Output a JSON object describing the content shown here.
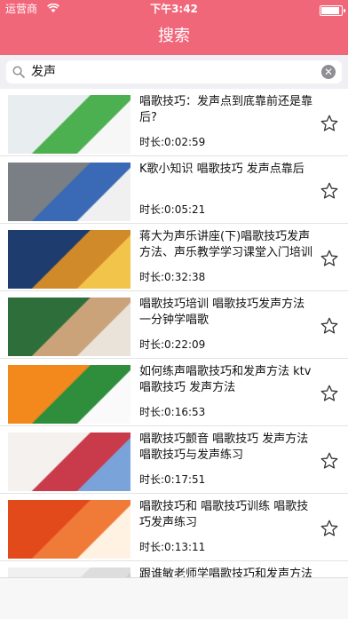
{
  "status": {
    "carrier": "运营商",
    "time": "下午3:42"
  },
  "nav": {
    "title": "搜索"
  },
  "search": {
    "query": "发声",
    "clear_label": "✕"
  },
  "videos": [
    {
      "title": "唱歌技巧：发声点到底靠前还是靠后?",
      "duration": "时长:0:02:59",
      "colors": [
        "#e8eef0",
        "#4caf50",
        "#f7f7f7"
      ]
    },
    {
      "title": "K歌小知识 唱歌技巧 发声点靠后",
      "duration": "时长:0:05:21",
      "colors": [
        "#7a7f86",
        "#3a6ab5",
        "#f0f0f0"
      ]
    },
    {
      "title": "蒋大为声乐讲座(下)唱歌技巧发声方法、声乐教学学习课堂入门培训",
      "duration": "时长:0:32:38",
      "colors": [
        "#1e3c6e",
        "#d18a2a",
        "#f2c44a"
      ]
    },
    {
      "title": "唱歌技巧培训 唱歌技巧发声方法 一分钟学唱歌",
      "duration": "时长:0:22:09",
      "colors": [
        "#2e6e3a",
        "#caa37a",
        "#e9e3da"
      ]
    },
    {
      "title": "如何练声唱歌技巧和发声方法 ktv唱歌技巧 发声方法",
      "duration": "时长:0:16:53",
      "colors": [
        "#f3891c",
        "#2f8e3c",
        "#fafafa"
      ]
    },
    {
      "title": "唱歌技巧颤音 唱歌技巧 发声方法唱歌技巧与发声练习",
      "duration": "时长:0:17:51",
      "colors": [
        "#f4f1ee",
        "#c93a4a",
        "#7aa3d9"
      ]
    },
    {
      "title": "唱歌技巧和 唱歌技巧训练 唱歌技巧发声练习",
      "duration": "时长:0:13:11",
      "colors": [
        "#e24a1c",
        "#f07a38",
        "#fff2e2"
      ]
    },
    {
      "title": "跟谁敏老师学唱歌技巧和发声方法",
      "duration": "",
      "colors": [
        "#f0f0f0",
        "#dddddd",
        "#cccccc"
      ]
    }
  ]
}
